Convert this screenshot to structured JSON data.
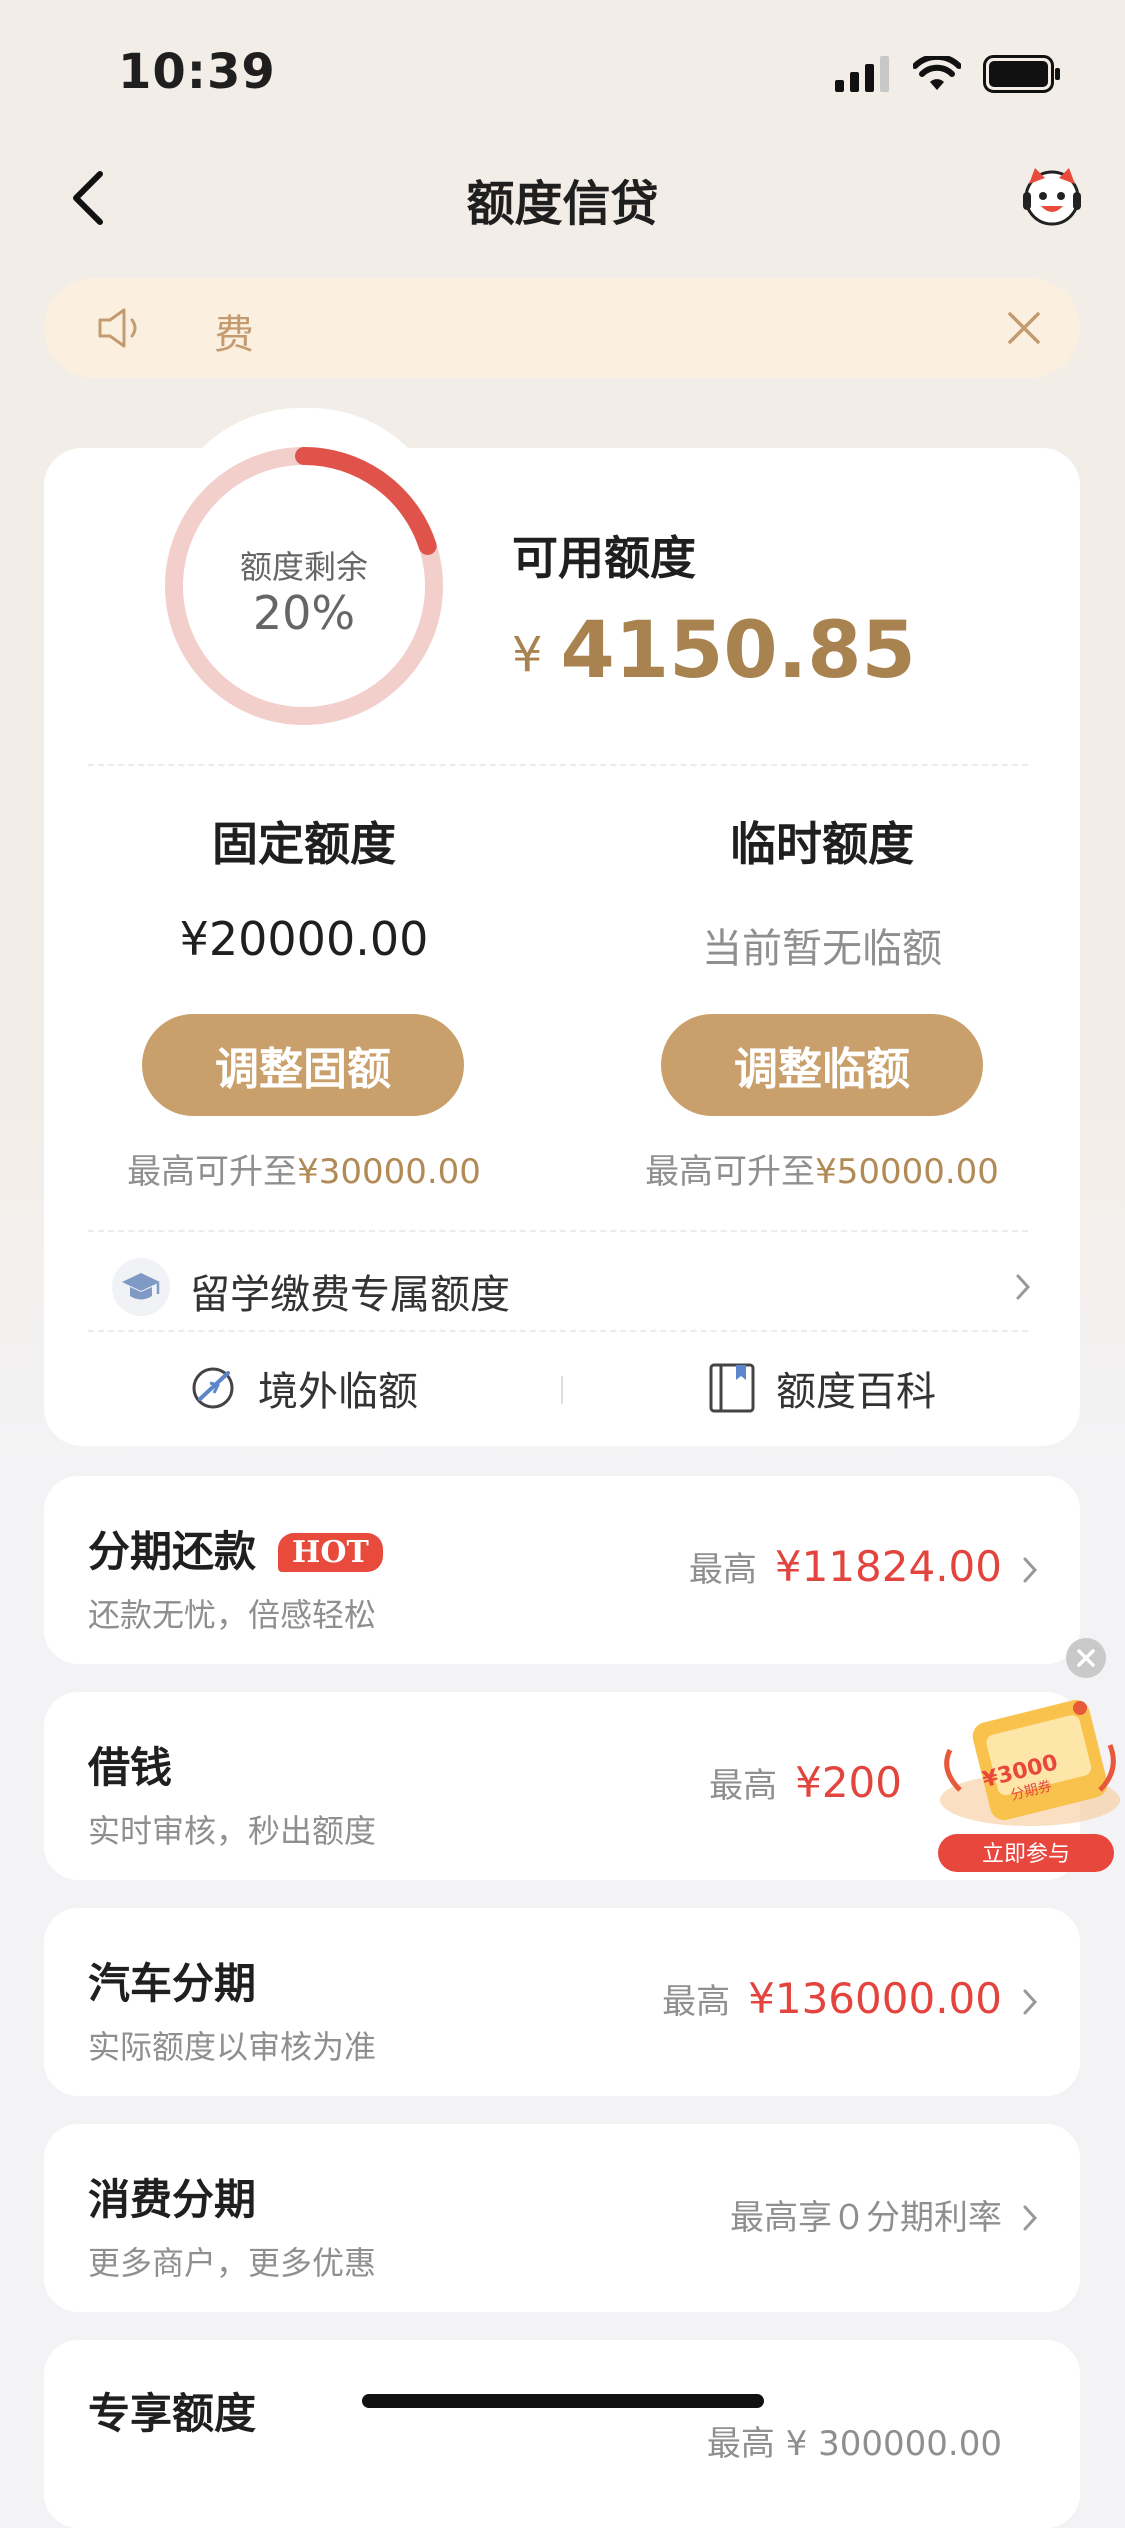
{
  "status_bar": {
    "time": "10:39"
  },
  "nav": {
    "title": "额度信贷"
  },
  "notice": {
    "text": "费"
  },
  "credit": {
    "ring_label": "额度剩余",
    "ring_percent": "20%",
    "ring_fraction": 0.2,
    "available_label": "可用额度",
    "available_currency": "¥",
    "available_amount": "4150.85"
  },
  "fixed": {
    "title": "固定额度",
    "value": "¥20000.00",
    "button": "调整固额",
    "note_prefix": "最高可升至",
    "note_amount": "¥30000.00"
  },
  "temp": {
    "title": "临时额度",
    "value": "当前暂无临额",
    "button": "调整临额",
    "note_prefix": "最高可升至",
    "note_amount": "¥50000.00"
  },
  "study_abroad": {
    "label": "留学缴费专属额度"
  },
  "links": {
    "overseas": "境外临额",
    "wiki": "额度百科"
  },
  "items": [
    {
      "title": "分期还款",
      "badge": "HOT",
      "subtitle": "还款无忧，倍感轻松",
      "right_prefix": "最高",
      "right_amount": "¥11824.00"
    },
    {
      "title": "借钱",
      "subtitle": "实时审核，秒出额度",
      "right_prefix": "最高",
      "right_amount": "¥200"
    },
    {
      "title": "汽车分期",
      "subtitle": "实际额度以审核为准",
      "right_prefix": "最高",
      "right_amount": "¥136000.00"
    },
    {
      "title": "消费分期",
      "subtitle": "更多商户，更多优惠",
      "right_prefix": "最高享０分期利率",
      "right_amount": ""
    },
    {
      "title": "专享额度",
      "subtitle": "",
      "right_prefix": "最高 ¥ 300000.00",
      "right_amount": ""
    }
  ],
  "promo": {
    "coupon_amount": "¥3000",
    "coupon_label": "分期券",
    "cta": "立即参与"
  },
  "colors": {
    "gold": "#c9a06c",
    "red": "#e3443e",
    "ring_track": "#f3cfcc",
    "ring_fill": "#e0534a"
  }
}
